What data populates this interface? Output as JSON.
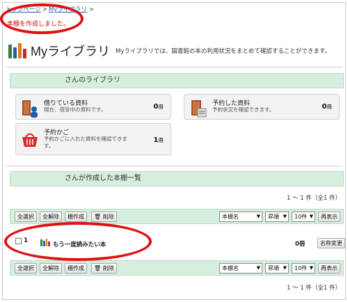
{
  "breadcrumb": {
    "top": "トップページ",
    "current": "Myライブラリ",
    "separator": ">"
  },
  "message": "本棚を作成しました。",
  "header": {
    "title": "Myライブラリ",
    "description": "Myライブラリでは、図書館の本の利用状況をまとめて確認することができます。"
  },
  "library_section": {
    "heading": "さんのライブラリ"
  },
  "cards": [
    {
      "title": "借りている資料",
      "subtitle": "現在、借受中の資料です。",
      "count": "0",
      "unit": "冊",
      "icon": "books-person-icon"
    },
    {
      "title": "予約した資料",
      "subtitle": "予約状況を確認できます。",
      "count": "0",
      "unit": "冊",
      "icon": "reserved-book-icon"
    },
    {
      "title": "予約かご",
      "subtitle": "予約かごに入れた資料を確認できます。",
      "count": "1",
      "unit": "冊",
      "icon": "basket-icon"
    }
  ],
  "shelf_section": {
    "heading": "さんが作成した本棚一覧"
  },
  "result_count": "1 ～ 1 件（全1 件）",
  "toolbar": {
    "select_all": "全選択",
    "deselect_all": "全解除",
    "create_shelf": "棚作成",
    "delete": "削除",
    "sort_field": "本棚名",
    "sort_order": "昇順",
    "per_page": "10件",
    "redisplay": "再表示"
  },
  "shelves": [
    {
      "number": "1",
      "name": "もう一度読みたい本",
      "count": "0冊",
      "rename_label": "名称変更"
    }
  ],
  "colors": {
    "accent_green": "#d6eedd",
    "annotation_red": "#e01010",
    "link_blue": "#1a5fb4"
  }
}
